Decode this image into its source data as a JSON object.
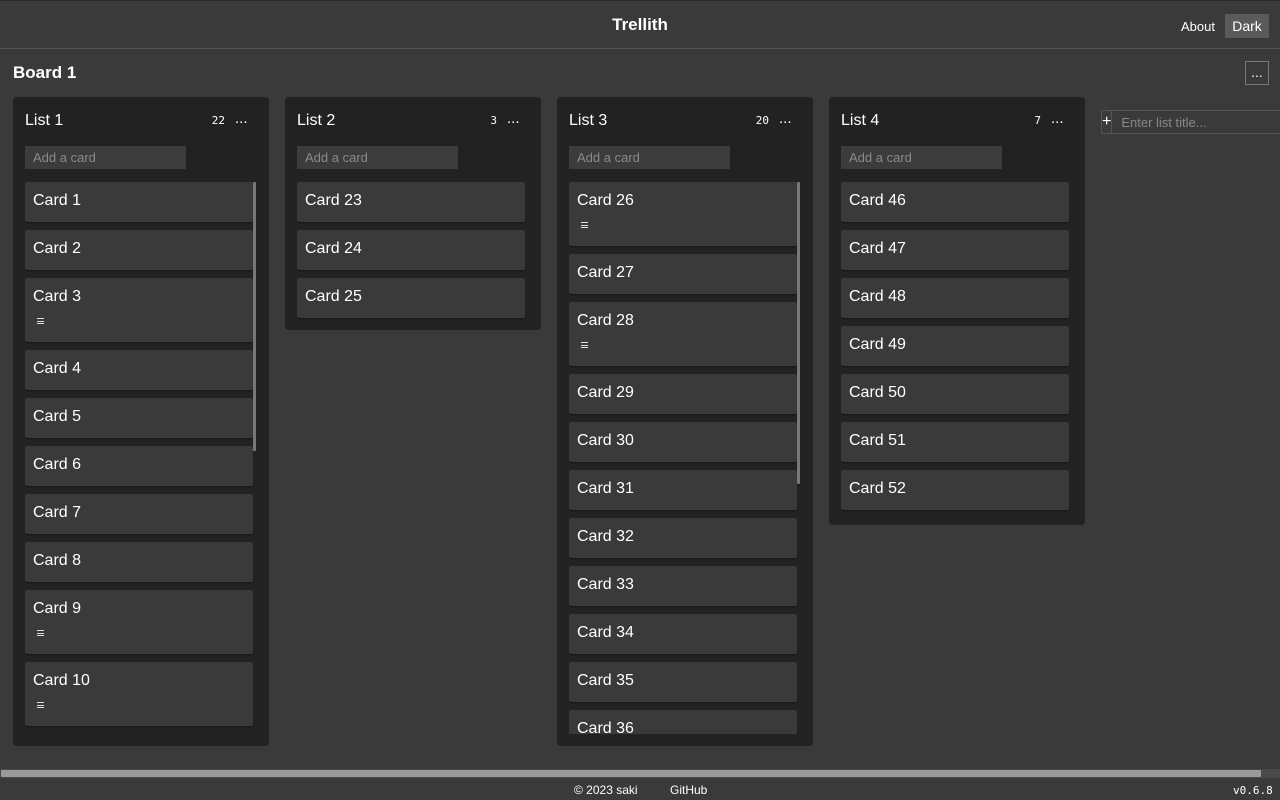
{
  "header": {
    "title": "Trellith",
    "about_label": "About",
    "theme_label": "Dark"
  },
  "board": {
    "title": "Board 1",
    "menu_label": "..."
  },
  "add_card_placeholder": "Add a card",
  "list_menu_label": "...",
  "lists": [
    {
      "title": "List 1",
      "count": "22",
      "cards": [
        {
          "label": "Card 1",
          "desc": false
        },
        {
          "label": "Card 2",
          "desc": false
        },
        {
          "label": "Card 3",
          "desc": true
        },
        {
          "label": "Card 4",
          "desc": false
        },
        {
          "label": "Card 5",
          "desc": false
        },
        {
          "label": "Card 6",
          "desc": false
        },
        {
          "label": "Card 7",
          "desc": false
        },
        {
          "label": "Card 8",
          "desc": false
        },
        {
          "label": "Card 9",
          "desc": true
        },
        {
          "label": "Card 10",
          "desc": true
        }
      ]
    },
    {
      "title": "List 2",
      "count": "3",
      "cards": [
        {
          "label": "Card 23",
          "desc": false
        },
        {
          "label": "Card 24",
          "desc": false
        },
        {
          "label": "Card 25",
          "desc": false
        }
      ]
    },
    {
      "title": "List 3",
      "count": "20",
      "cards": [
        {
          "label": "Card 26",
          "desc": true
        },
        {
          "label": "Card 27",
          "desc": false
        },
        {
          "label": "Card 28",
          "desc": true
        },
        {
          "label": "Card 29",
          "desc": false
        },
        {
          "label": "Card 30",
          "desc": false
        },
        {
          "label": "Card 31",
          "desc": false
        },
        {
          "label": "Card 32",
          "desc": false
        },
        {
          "label": "Card 33",
          "desc": false
        },
        {
          "label": "Card 34",
          "desc": false
        },
        {
          "label": "Card 35",
          "desc": false
        },
        {
          "label": "Card 36",
          "desc": false
        }
      ]
    },
    {
      "title": "List 4",
      "count": "7",
      "cards": [
        {
          "label": "Card 46",
          "desc": false
        },
        {
          "label": "Card 47",
          "desc": false
        },
        {
          "label": "Card 48",
          "desc": false
        },
        {
          "label": "Card 49",
          "desc": false
        },
        {
          "label": "Card 50",
          "desc": false
        },
        {
          "label": "Card 51",
          "desc": false
        },
        {
          "label": "Card 52",
          "desc": false
        }
      ]
    }
  ],
  "new_list": {
    "button_label": "+",
    "placeholder": "Enter list title..."
  },
  "footer": {
    "copyright": "© 2023 saki",
    "github_label": "GitHub",
    "version": "v0.6.8"
  },
  "icons": {
    "description": "description-icon",
    "add": "plus-icon"
  }
}
